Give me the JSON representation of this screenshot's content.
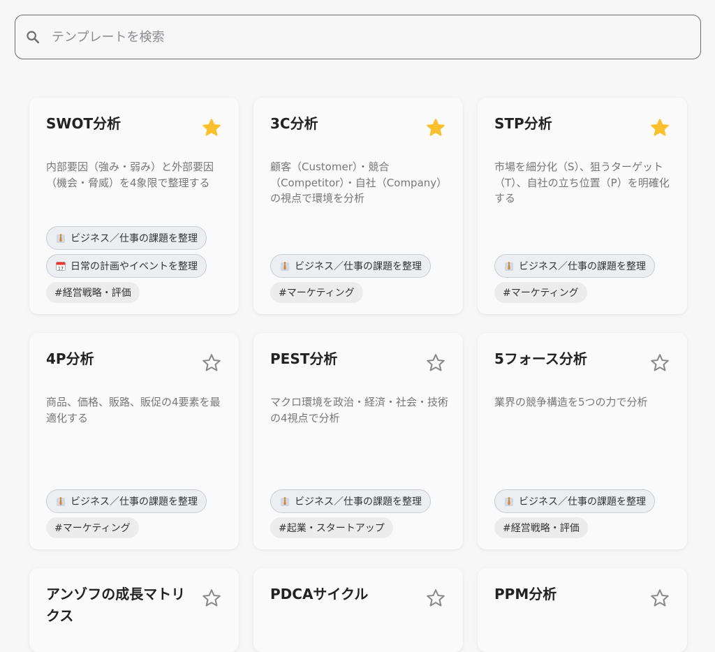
{
  "search": {
    "placeholder": "テンプレートを検索",
    "value": ""
  },
  "colors": {
    "star_active": "#fbc02d",
    "star_inactive": "#8a8a8a"
  },
  "cards": [
    {
      "title": "SWOT分析",
      "favorite": true,
      "description": "内部要因（強み・弱み）と外部要因（機会・脅威）を4象限で整理する",
      "chips": [
        {
          "icon": "necktie-icon",
          "label": "ビジネス／仕事の課題を整理"
        },
        {
          "icon": "calendar-icon",
          "label": "日常の計画やイベントを整理"
        }
      ],
      "hashtags": [
        "#経営戦略・評価"
      ]
    },
    {
      "title": "3C分析",
      "favorite": true,
      "description": "顧客（Customer）・競合（Competitor）・自社（Company）の視点で環境を分析",
      "chips": [
        {
          "icon": "necktie-icon",
          "label": "ビジネス／仕事の課題を整理"
        }
      ],
      "hashtags": [
        "#マーケティング"
      ]
    },
    {
      "title": "STP分析",
      "favorite": true,
      "description": "市場を細分化（S）、狙うターゲット（T）、自社の立ち位置（P）を明確化する",
      "chips": [
        {
          "icon": "necktie-icon",
          "label": "ビジネス／仕事の課題を整理"
        }
      ],
      "hashtags": [
        "#マーケティング"
      ]
    },
    {
      "title": "4P分析",
      "favorite": false,
      "description": "商品、価格、販路、販促の4要素を最適化する",
      "chips": [
        {
          "icon": "necktie-icon",
          "label": "ビジネス／仕事の課題を整理"
        }
      ],
      "hashtags": [
        "#マーケティング"
      ]
    },
    {
      "title": "PEST分析",
      "favorite": false,
      "description": "マクロ環境を政治・経済・社会・技術の4視点で分析",
      "chips": [
        {
          "icon": "necktie-icon",
          "label": "ビジネス／仕事の課題を整理"
        }
      ],
      "hashtags": [
        "#起業・スタートアップ"
      ]
    },
    {
      "title": "5フォース分析",
      "favorite": false,
      "description": "業界の競争構造を5つの力で分析",
      "chips": [
        {
          "icon": "necktie-icon",
          "label": "ビジネス／仕事の課題を整理"
        }
      ],
      "hashtags": [
        "#経営戦略・評価"
      ]
    },
    {
      "title": "アンゾフの成長マトリクス",
      "favorite": false,
      "description": "",
      "chips": [],
      "hashtags": []
    },
    {
      "title": "PDCAサイクル",
      "favorite": false,
      "description": "",
      "chips": [],
      "hashtags": []
    },
    {
      "title": "PPM分析",
      "favorite": false,
      "description": "",
      "chips": [],
      "hashtags": []
    }
  ]
}
